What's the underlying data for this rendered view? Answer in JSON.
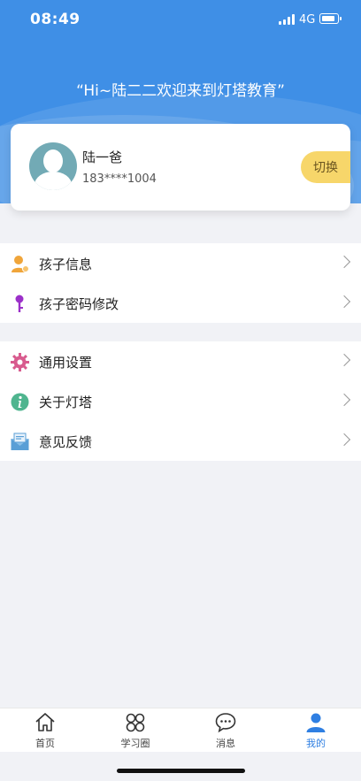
{
  "status_bar": {
    "time": "08:49",
    "network": "4G"
  },
  "header": {
    "welcome_text": "“Hi~陆二二欢迎来到灯塔教育”"
  },
  "profile": {
    "name": "陆一爸",
    "phone": "183****1004",
    "switch_label": "切换"
  },
  "menu_groups": [
    {
      "items": [
        {
          "label": "孩子信息",
          "icon": "child-info-icon"
        },
        {
          "label": "孩子密码修改",
          "icon": "key-icon"
        }
      ]
    },
    {
      "items": [
        {
          "label": "通用设置",
          "icon": "gear-icon"
        },
        {
          "label": "关于灯塔",
          "icon": "info-icon"
        },
        {
          "label": "意见反馈",
          "icon": "feedback-mail-icon"
        }
      ]
    }
  ],
  "tab_bar": {
    "active_index": 3,
    "tabs": [
      {
        "label": "首页",
        "icon": "home-icon"
      },
      {
        "label": "学习圈",
        "icon": "study-circle-icon"
      },
      {
        "label": "消息",
        "icon": "message-icon"
      },
      {
        "label": "我的",
        "icon": "profile-icon"
      }
    ]
  },
  "colors": {
    "header_blue": "#3f8fe6",
    "switch_yellow": "#f7d66a",
    "active_tab_blue": "#2f7fe2",
    "page_bg": "#f1f2f6"
  }
}
